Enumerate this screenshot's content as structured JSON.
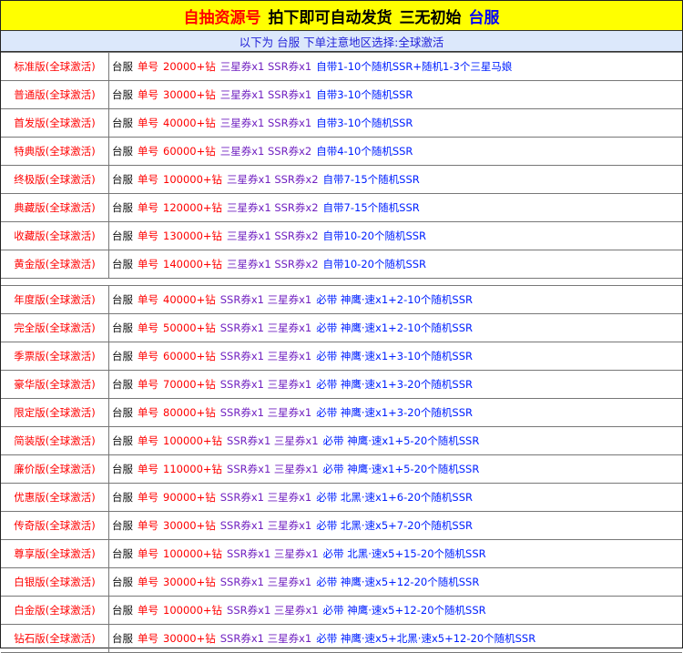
{
  "banner": {
    "part1": "自抽资源号",
    "part2": "拍下即可自动发货",
    "part3": "三无初始",
    "part4": "台服"
  },
  "subtitle": "以下为 台服 下单注意地区选择:全球激活",
  "colors": {
    "banner_bg": "#ffff00",
    "subtitle_bg": "#dce8fb",
    "red": "#ff0000",
    "purple": "#7020c0",
    "blue": "#0020ff"
  },
  "group1": [
    {
      "name": "标准版(全球激活)",
      "server": "台服",
      "account": "单号",
      "diamonds": "20000+钻",
      "coupons": "三星券x1 SSR券x1",
      "rest": "自带1-10个随机SSR+随机1-3个三星马娘"
    },
    {
      "name": "普通版(全球激活)",
      "server": "台服",
      "account": "单号",
      "diamonds": "30000+钻",
      "coupons": "三星券x1 SSR券x1",
      "rest": "自带3-10个随机SSR"
    },
    {
      "name": "首发版(全球激活)",
      "server": "台服",
      "account": "单号",
      "diamonds": "40000+钻",
      "coupons": "三星券x1 SSR券x1",
      "rest": "自带3-10个随机SSR"
    },
    {
      "name": "特典版(全球激活)",
      "server": "台服",
      "account": "单号",
      "diamonds": "60000+钻",
      "coupons": "三星券x1 SSR券x2",
      "rest": "自带4-10个随机SSR"
    },
    {
      "name": "终极版(全球激活)",
      "server": "台服",
      "account": "单号",
      "diamonds": "100000+钻",
      "coupons": "三星券x1 SSR券x2",
      "rest": "自带7-15个随机SSR"
    },
    {
      "name": "典藏版(全球激活)",
      "server": "台服",
      "account": "单号",
      "diamonds": "120000+钻",
      "coupons": "三星券x1 SSR券x2",
      "rest": "自带7-15个随机SSR"
    },
    {
      "name": "收藏版(全球激活)",
      "server": "台服",
      "account": "单号",
      "diamonds": "130000+钻",
      "coupons": "三星券x1 SSR券x2",
      "rest": "自带10-20个随机SSR"
    },
    {
      "name": "黄金版(全球激活)",
      "server": "台服",
      "account": "单号",
      "diamonds": "140000+钻",
      "coupons": "三星券x1 SSR券x2",
      "rest": "自带10-20个随机SSR"
    }
  ],
  "group2": [
    {
      "name": "年度版(全球激活)",
      "server": "台服",
      "account": "单号",
      "diamonds": "40000+钻",
      "coupons": "SSR券x1 三星券x1",
      "rest": "必带 神鹰·速x1+2-10个随机SSR"
    },
    {
      "name": "完全版(全球激活)",
      "server": "台服",
      "account": "单号",
      "diamonds": "50000+钻",
      "coupons": "SSR券x1 三星券x1",
      "rest": "必带 神鹰·速x1+2-10个随机SSR"
    },
    {
      "name": "季票版(全球激活)",
      "server": "台服",
      "account": "单号",
      "diamonds": "60000+钻",
      "coupons": "SSR券x1 三星券x1",
      "rest": "必带 神鹰·速x1+3-10个随机SSR"
    },
    {
      "name": "豪华版(全球激活)",
      "server": "台服",
      "account": "单号",
      "diamonds": "70000+钻",
      "coupons": "SSR券x1 三星券x1",
      "rest": "必带 神鹰·速x1+3-20个随机SSR"
    },
    {
      "name": "限定版(全球激活)",
      "server": "台服",
      "account": "单号",
      "diamonds": "80000+钻",
      "coupons": "SSR券x1 三星券x1",
      "rest": "必带 神鹰·速x1+3-20个随机SSR"
    },
    {
      "name": "简装版(全球激活)",
      "server": "台服",
      "account": "单号",
      "diamonds": "100000+钻",
      "coupons": "SSR券x1 三星券x1",
      "rest": "必带 神鹰·速x1+5-20个随机SSR"
    },
    {
      "name": "廉价版(全球激活)",
      "server": "台服",
      "account": "单号",
      "diamonds": "110000+钻",
      "coupons": "SSR券x1 三星券x1",
      "rest": "必带 神鹰·速x1+5-20个随机SSR"
    },
    {
      "name": "优惠版(全球激活)",
      "server": "台服",
      "account": "单号",
      "diamonds": "90000+钻",
      "coupons": "SSR券x1 三星券x1",
      "rest": "必带 北黑·速x1+6-20个随机SSR"
    },
    {
      "name": "传奇版(全球激活)",
      "server": "台服",
      "account": "单号",
      "diamonds": "30000+钻",
      "coupons": "SSR券x1 三星券x1",
      "rest": "必带 北黑·速x5+7-20个随机SSR"
    },
    {
      "name": "尊享版(全球激活)",
      "server": "台服",
      "account": "单号",
      "diamonds": "100000+钻",
      "coupons": "SSR券x1 三星券x1",
      "rest": "必带 北黑·速x5+15-20个随机SSR"
    },
    {
      "name": "白银版(全球激活)",
      "server": "台服",
      "account": "单号",
      "diamonds": "30000+钻",
      "coupons": "SSR券x1 三星券x1",
      "rest": "必带 神鹰·速x5+12-20个随机SSR"
    },
    {
      "name": "白金版(全球激活)",
      "server": "台服",
      "account": "单号",
      "diamonds": "100000+钻",
      "coupons": "SSR券x1 三星券x1",
      "rest": "必带 神鹰·速x5+12-20个随机SSR"
    },
    {
      "name": "钻石版(全球激活)",
      "server": "台服",
      "account": "单号",
      "diamonds": "30000+钻",
      "coupons": "SSR券x1 三星券x1",
      "rest": "必带 神鹰·速x5+北黑·速x5+12-20个随机SSR"
    }
  ]
}
